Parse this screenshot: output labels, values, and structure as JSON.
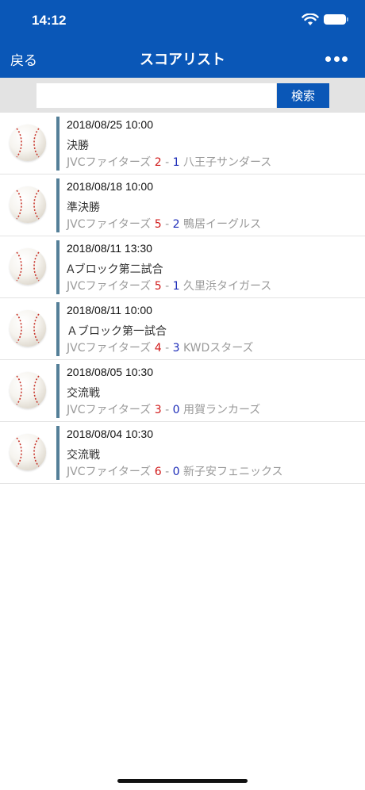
{
  "status_bar": {
    "time": "14:12"
  },
  "nav": {
    "back_label": "戻る",
    "title": "スコアリスト"
  },
  "search": {
    "input_value": "",
    "placeholder": "",
    "button_label": "検索"
  },
  "games": [
    {
      "datetime": "2018/08/25 10:00",
      "name": "決勝",
      "home_team": "JVCファイターズ",
      "home_score": "2",
      "dash": "-",
      "away_score": "1",
      "away_team": "八王子サンダース"
    },
    {
      "datetime": "2018/08/18 10:00",
      "name": "準決勝",
      "home_team": "JVCファイターズ",
      "home_score": "5",
      "dash": "-",
      "away_score": "2",
      "away_team": "鴨居イーグルス"
    },
    {
      "datetime": "2018/08/11 13:30",
      "name": "Aブロック第二試合",
      "home_team": "JVCファイターズ",
      "home_score": "5",
      "dash": "-",
      "away_score": "1",
      "away_team": "久里浜タイガース"
    },
    {
      "datetime": "2018/08/11 10:00",
      "name": "Ａブロック第一試合",
      "home_team": "JVCファイターズ",
      "home_score": "4",
      "dash": "-",
      "away_score": "3",
      "away_team": "KWDスターズ"
    },
    {
      "datetime": "2018/08/05 10:30",
      "name": "交流戦",
      "home_team": "JVCファイターズ",
      "home_score": "3",
      "dash": "-",
      "away_score": "0",
      "away_team": "用賀ランカーズ"
    },
    {
      "datetime": "2018/08/04 10:30",
      "name": "交流戦",
      "home_team": "JVCファイターズ",
      "home_score": "6",
      "dash": "-",
      "away_score": "0",
      "away_team": "新子安フェニックス"
    }
  ],
  "icons": {
    "row_icon": "baseball-icon",
    "more": "more-dots-icon",
    "wifi": "wifi-icon",
    "battery": "battery-icon"
  },
  "colors": {
    "header": "#0a57b7",
    "home_score": "#d11a1a",
    "away_score": "#1c2bb8",
    "row_bar": "#547f98"
  }
}
